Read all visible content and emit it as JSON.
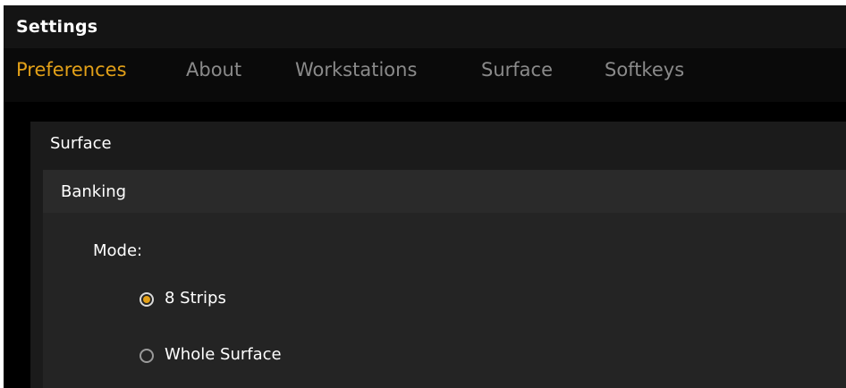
{
  "window": {
    "title": "Settings"
  },
  "tabs": [
    {
      "label": "Preferences",
      "active": true
    },
    {
      "label": "About",
      "active": false
    },
    {
      "label": "Workstations",
      "active": false
    },
    {
      "label": "Surface",
      "active": false
    },
    {
      "label": "Softkeys",
      "active": false
    }
  ],
  "panel": {
    "title": "Surface",
    "section": {
      "title": "Banking",
      "mode_label": "Mode:",
      "options": [
        {
          "label": "8 Strips",
          "selected": true
        },
        {
          "label": "Whole Surface",
          "selected": false
        }
      ]
    }
  },
  "colors": {
    "accent": "#e2a018",
    "inactive_tab": "#8a8a8a",
    "text": "#ffffff",
    "background": "#000000",
    "panel": "#1b1b1b",
    "section": "#242424"
  }
}
